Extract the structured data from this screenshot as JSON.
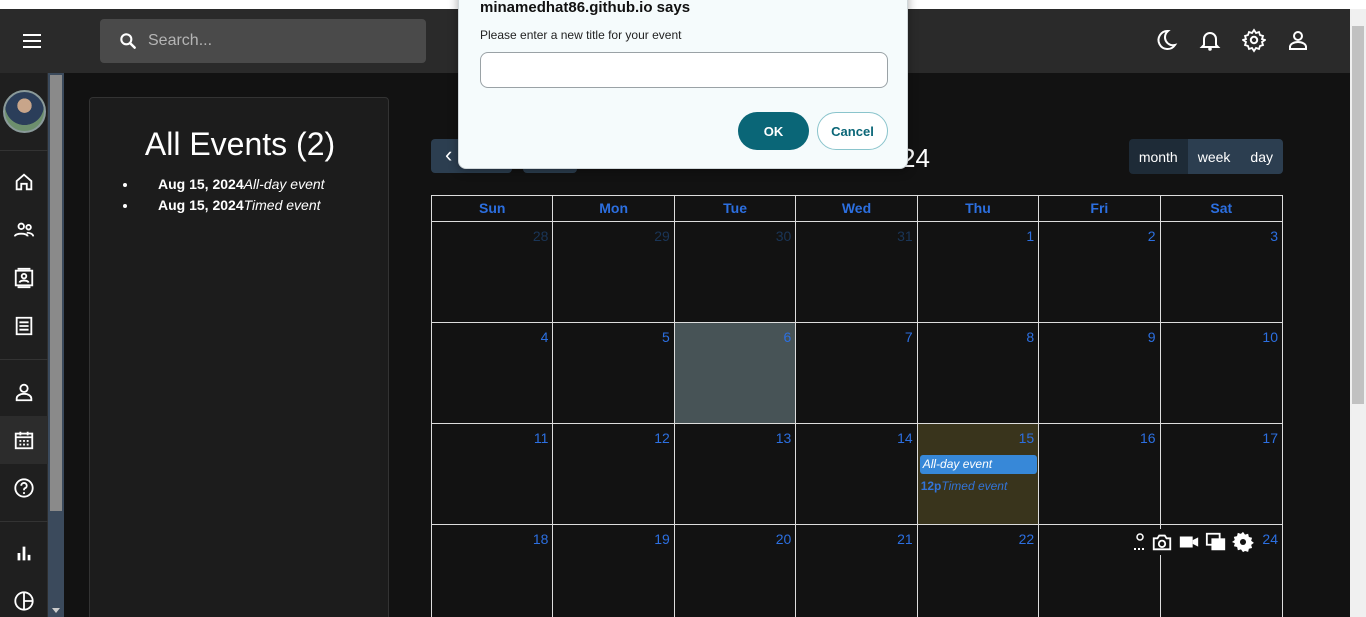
{
  "topbar": {
    "search_placeholder": "Search...",
    "icons": [
      "menu-icon",
      "search-icon",
      "moon-icon",
      "bell-icon",
      "gear-icon",
      "user-icon"
    ]
  },
  "sidebar": {
    "items": [
      "home-icon",
      "people-icon",
      "contacts-icon",
      "receipt-icon",
      "profile-icon",
      "calendar-icon",
      "help-icon",
      "bar-chart-icon",
      "pie-chart-icon"
    ],
    "active": "calendar-icon"
  },
  "events_panel": {
    "title": "All Events (2)",
    "events": [
      {
        "date": "Aug 15, 2024",
        "title": "All-day event"
      },
      {
        "date": "Aug 15, 2024",
        "title": "Timed event"
      }
    ]
  },
  "calendar": {
    "title_visible": "24",
    "views": [
      "month",
      "week",
      "day"
    ],
    "days_of_week": [
      "Sun",
      "Mon",
      "Tue",
      "Wed",
      "Thu",
      "Fri",
      "Sat"
    ],
    "weeks": [
      [
        "28",
        "29",
        "30",
        "31",
        "1",
        "2",
        "3"
      ],
      [
        "4",
        "5",
        "6",
        "7",
        "8",
        "9",
        "10"
      ],
      [
        "11",
        "12",
        "13",
        "14",
        "15",
        "16",
        "17"
      ],
      [
        "18",
        "19",
        "20",
        "21",
        "22",
        "",
        "24"
      ]
    ],
    "allday_event": "All-day event",
    "timed_event_time": "12p",
    "timed_event_title": "Timed event",
    "colors": {
      "accent": "#2c6fe0",
      "event": "#3788d8",
      "today": "#39341c",
      "selected": "#475356"
    }
  },
  "dialog": {
    "title": "minamedhat86.github.io says",
    "message": "Please enter a new title for your event",
    "input_value": "",
    "ok_label": "OK",
    "cancel_label": "Cancel"
  },
  "floating_toolbar": [
    "screenshot-icon",
    "camera-icon",
    "video-icon",
    "copy-windows-icon",
    "gear-icon"
  ]
}
